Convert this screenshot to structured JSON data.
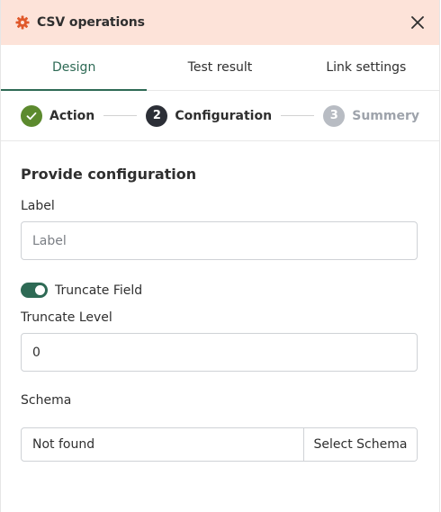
{
  "header": {
    "title": "CSV operations",
    "icon": "gear-icon",
    "accent_color": "#e0582a",
    "background_color": "#fde3d9"
  },
  "tabs": [
    {
      "label": "Design",
      "active": true
    },
    {
      "label": "Test result",
      "active": false
    },
    {
      "label": "Link settings",
      "active": false
    }
  ],
  "stepper": {
    "steps": [
      {
        "number": "",
        "label": "Action",
        "state": "done"
      },
      {
        "number": "2",
        "label": "Configuration",
        "state": "current"
      },
      {
        "number": "3",
        "label": "Summery",
        "state": "pending"
      }
    ]
  },
  "form": {
    "title": "Provide configuration",
    "label_field": {
      "label": "Label",
      "value": "",
      "placeholder": "Label"
    },
    "truncate_toggle": {
      "label": "Truncate Field",
      "on": true
    },
    "truncate_level": {
      "label": "Truncate Level",
      "value": "0"
    },
    "schema": {
      "label": "Schema",
      "value": "Not found",
      "button_label": "Select Schema"
    }
  },
  "colors": {
    "primary": "#2e6a55",
    "step_done": "#5c8a2e",
    "step_current": "#2c2f37",
    "step_pending": "#b8bcc3"
  }
}
